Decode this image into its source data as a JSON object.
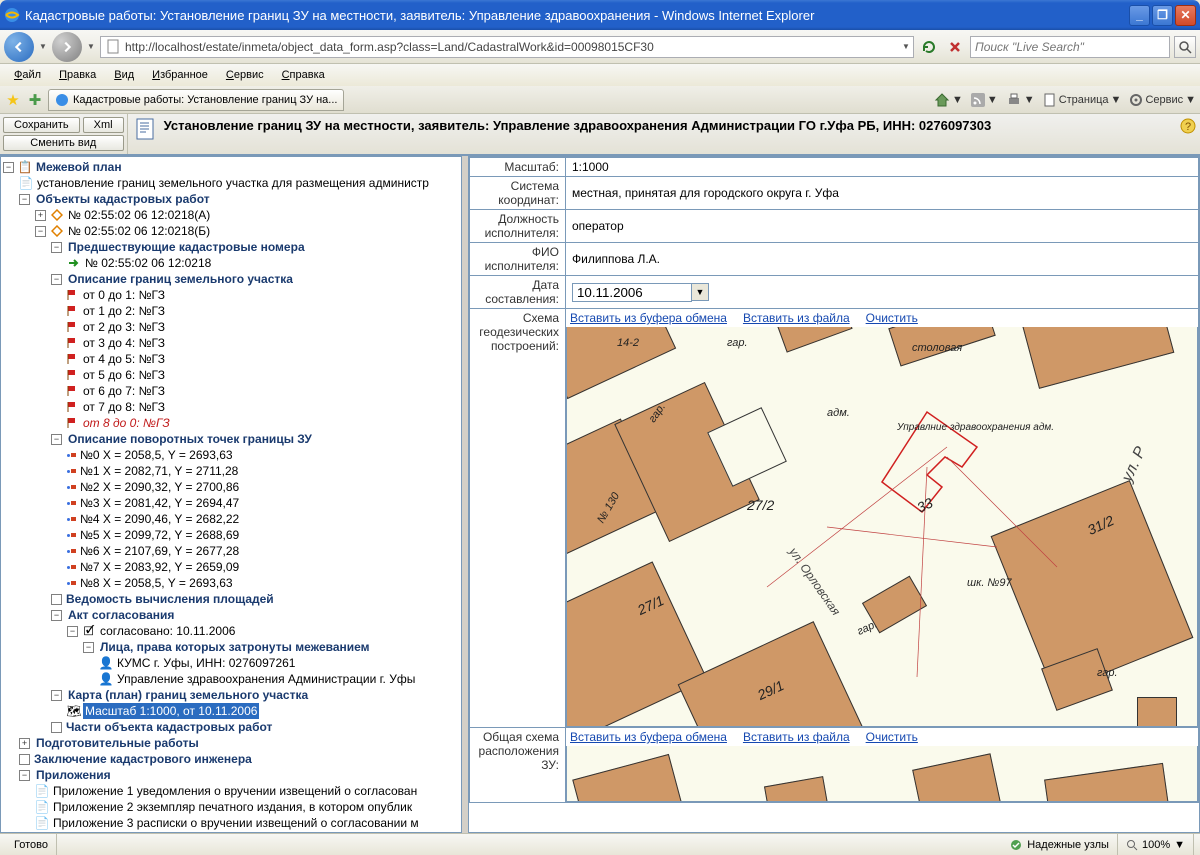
{
  "window": {
    "title": "Кадастровые работы: Установление границ ЗУ на местности, заявитель: Управление здравоохранения  - Windows Internet Explorer",
    "url": "http://localhost/estate/inmeta/object_data_form.asp?class=Land/CadastralWork&id=00098015CF30",
    "search_placeholder": "Поиск \"Live Search\""
  },
  "menu": [
    "Файл",
    "Правка",
    "Вид",
    "Избранное",
    "Сервис",
    "Справка"
  ],
  "tab": {
    "title": "Кадастровые работы: Установление границ ЗУ на..."
  },
  "tabbar_tools": {
    "page": "Страница",
    "service": "Сервис"
  },
  "toolbar": {
    "save": "Сохранить",
    "xml": "Xml",
    "change_view": "Сменить вид"
  },
  "app_title": "Установление границ ЗУ на местности, заявитель: Управление здравоохранения Администрации ГО г.Уфа РБ, ИНН: 0276097303",
  "tree": {
    "root": "Межевой план",
    "root_sub": "установление границ земельного участка для размещения администр",
    "objects": "Объекты кадастровых работ",
    "obj_a": "№ 02:55:02 06 12:0218(А)",
    "obj_b": "№ 02:55:02 06 12:0218(Б)",
    "prev_numbers": "Предшествующие кадастровые номера",
    "prev_n1": "№ 02:55:02 06 12:0218",
    "boundary_desc": "Описание границ земельного участка",
    "segments": [
      "от 0 до 1: №ГЗ",
      "от 1 до 2: №ГЗ",
      "от 2 до 3: №ГЗ",
      "от 3 до 4: №ГЗ",
      "от 4 до 5: №ГЗ",
      "от 5 до 6: №ГЗ",
      "от 6 до 7: №ГЗ",
      "от 7 до 8: №ГЗ",
      "от 8 до 0: №ГЗ"
    ],
    "points_desc": "Описание поворотных точек границы ЗУ",
    "points": [
      "№0 X = 2058,5, Y = 2693,63",
      "№1 X = 2082,71, Y = 2711,28",
      "№2 X = 2090,32, Y = 2700,86",
      "№3 X = 2081,42, Y = 2694,47",
      "№4 X = 2090,46, Y = 2682,22",
      "№5 X = 2099,72, Y = 2688,69",
      "№6 X = 2107,69, Y = 2677,28",
      "№7 X = 2083,92, Y = 2659,09",
      "№8 X = 2058,5, Y = 2693,63"
    ],
    "area_calc": "Ведомость вычисления площадей",
    "agreement": "Акт согласования",
    "agreed": "согласовано: 10.11.2006",
    "affected": "Лица, права которых затронуты межеванием",
    "affected1": "КУМС г. Уфы, ИНН: 0276097261",
    "affected2": "Управление здравоохранения Администрации г. Уфы",
    "map_plan": "Карта (план) границ земельного участка",
    "map_scale": "Масштаб 1:1000, от 10.11.2006",
    "parts": "Части объекта кадастровых работ",
    "prep_work": "Подготовительные работы",
    "eng_conclusion": "Заключение кадастрового инженера",
    "attachments": "Приложения",
    "att1": "Приложение 1 уведомления о вручении извещений о согласован",
    "att2": "Приложение 2 экземпляр печатного издания, в котором опублик",
    "att3": "Приложение 3 расписки о вручении извещений о согласовании м"
  },
  "form": {
    "scale_label": "Масштаб:",
    "scale": "1:1000",
    "coords_label": "Система координат:",
    "coords": "местная, принятая для городского округа г. Уфа",
    "position_label": "Должность исполнителя:",
    "position": "оператор",
    "name_label": "ФИО исполнителя:",
    "name": "Филиппова Л.А.",
    "date_label": "Дата составления:",
    "date": "10.11.2006",
    "schema_label": "Схема геодезических построений:",
    "schema2_label": "Общая схема расположения ЗУ:",
    "insert_clip": "Вставить из буфера обмена",
    "insert_file": "Вставить из файла",
    "clear": "Очистить"
  },
  "map_labels": {
    "stolovaya": "столовая",
    "adm": "адм.",
    "upr": "Управлние здравоохранения адм.",
    "b142": "14-2",
    "gar": "гар.",
    "b130": "№ 130",
    "b272": "27/2",
    "b33": "33",
    "b312": "31/2",
    "shk": "шк. №97",
    "orl": "ул. Орловская",
    "r": "ул. Р",
    "b271": "27/1",
    "gar2": "гар.",
    "b291": "29/1",
    "gar3": "гар."
  },
  "status": {
    "ready": "Готово",
    "zone": "Надежные узлы",
    "zoom": "100%"
  }
}
